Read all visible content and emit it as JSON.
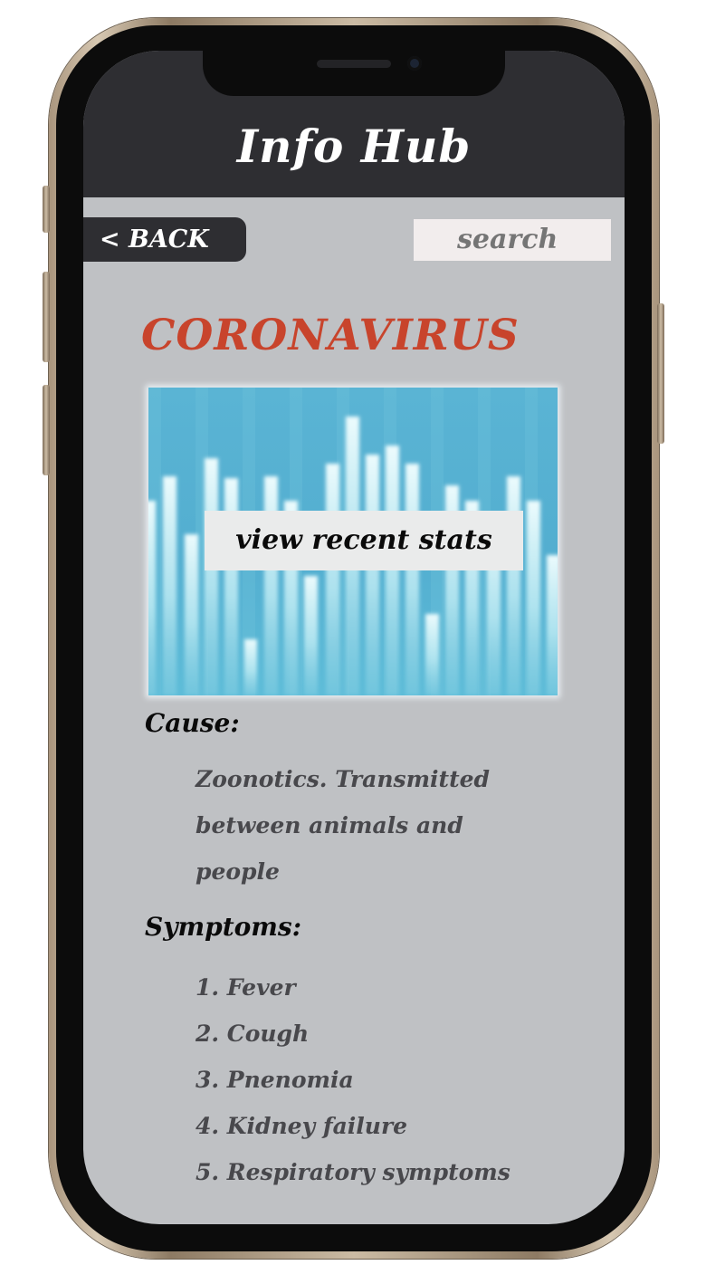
{
  "header": {
    "title": "Info Hub"
  },
  "toolbar": {
    "back_label": "< BACK",
    "search_placeholder": "search"
  },
  "main": {
    "disease_title": "CORONAVIRUS",
    "stats_button_label": "view recent stats",
    "cause": {
      "heading": "Cause:",
      "text": "Zoonotics. Transmitted between animals and people"
    },
    "symptoms": {
      "heading": "Symptoms:",
      "items": [
        "1. Fever",
        "2. Cough",
        "3. Pnenomia",
        "4. Kidney failure",
        "5. Respiratory symptoms"
      ]
    }
  },
  "colors": {
    "header_bg": "#2e2e32",
    "screen_bg": "#bfc1c4",
    "title_accent": "#c8442c",
    "stats_card_bg": "#5ab4d4"
  },
  "icons": {
    "stats_image": "bar-chart-image"
  }
}
